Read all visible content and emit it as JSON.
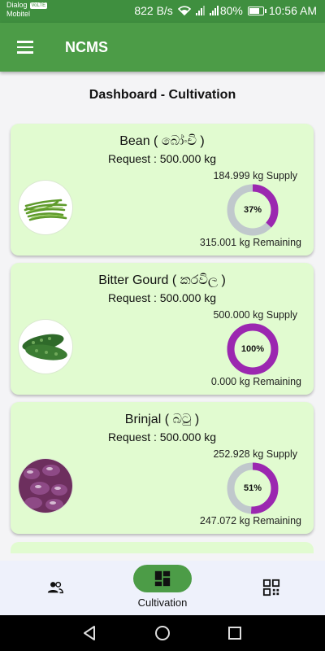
{
  "status_bar": {
    "carrier1": "Dialog",
    "vo_badge": "VoLTE",
    "carrier2": "Mobitel",
    "speed": "822 B/s",
    "battery": "80%",
    "battery_level": 0.8,
    "time": "10:56 AM"
  },
  "app_bar": {
    "title": "NCMS",
    "menu_icon": "hamburger-menu-icon"
  },
  "page_title": "Dashboard - Cultivation",
  "crops": [
    {
      "name": "Bean ( බෝංචි )",
      "request": "Request : 500.000 kg",
      "supply": "184.999 kg Supply",
      "remaining": "315.001 kg Remaining",
      "percent_label": "37%",
      "fraction": 0.37
    },
    {
      "name": "Bitter Gourd ( කරවිල )",
      "request": "Request : 500.000 kg",
      "supply": "500.000 kg Supply",
      "remaining": "0.000 kg Remaining",
      "percent_label": "100%",
      "fraction": 1.0
    },
    {
      "name": "Brinjal ( බටු )",
      "request": "Request : 500.000 kg",
      "supply": "252.928 kg Supply",
      "remaining": "247.072 kg Remaining",
      "percent_label": "51%",
      "fraction": 0.51
    }
  ],
  "colors": {
    "accent": "#4c9c47",
    "progress": "#9b27b0",
    "track": "#c0c8cc",
    "card": "#e1fbd0"
  },
  "bottom_nav": {
    "items": [
      {
        "icon": "people-icon",
        "label": ""
      },
      {
        "icon": "dashboard-icon",
        "label": "Cultivation",
        "active": true
      },
      {
        "icon": "qr-code-icon",
        "label": ""
      }
    ]
  },
  "system_nav": {
    "back": "back-icon",
    "home": "home-icon",
    "recents": "recents-icon"
  }
}
